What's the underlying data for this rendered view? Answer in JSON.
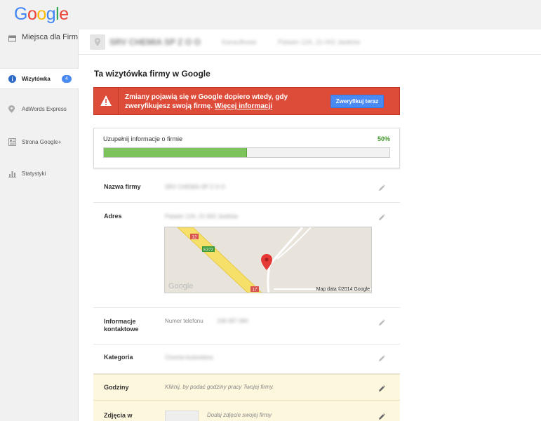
{
  "brand": {
    "logo_letters": [
      {
        "ch": "G",
        "color": "#4285f4"
      },
      {
        "ch": "o",
        "color": "#ea4335"
      },
      {
        "ch": "o",
        "color": "#fbbc05"
      },
      {
        "ch": "g",
        "color": "#4285f4"
      },
      {
        "ch": "l",
        "color": "#34a853"
      },
      {
        "ch": "e",
        "color": "#ea4335"
      }
    ]
  },
  "sidebar": {
    "places": "Miejsca dla Firm",
    "items": [
      {
        "label": "Wizytówka",
        "badge": "4",
        "icon": "info-icon"
      },
      {
        "label": "AdWords Express",
        "icon": "map-pin-icon"
      },
      {
        "label": "Strona Google+",
        "icon": "google-plus-page-icon"
      },
      {
        "label": "Statystyki",
        "icon": "bar-chart-icon"
      }
    ]
  },
  "header": {
    "business_name": "SRV CHEMIA SP Z O O",
    "sub1": "Kanaufkowe",
    "sub2": "Pataein 12A, 21-002 Jastków"
  },
  "main": {
    "title": "Ta wizytówka firmy w Google",
    "alert": {
      "message": "Zmiany pojawią się w Google dopiero wtedy, gdy zweryfikujesz swoją firmę.",
      "link": "Więcej informacji",
      "button": "Zweryfikuj teraz",
      "color": "#dd4b39"
    },
    "completion": {
      "label": "Uzupełnij informacje o firmie",
      "percent_text": "50%",
      "percent": 50
    },
    "rows": {
      "name": {
        "label": "Nazwa firmy",
        "value": "SRV CHEMIA SP Z O O"
      },
      "address": {
        "label": "Adres",
        "value": "Pataein 12A, 21-002 Jastków",
        "map_credit": "Map data ©2014 Google",
        "map_logo": "Google",
        "road_labels": [
          "12",
          "E372",
          "17"
        ]
      },
      "contact": {
        "label": "Informacje kontaktowe",
        "sublabel": "Numer telefonu",
        "value": "108 087 084"
      },
      "category": {
        "label": "Kategoria",
        "value": "Chemia budowlana"
      },
      "hours": {
        "label": "Godziny",
        "hint": "Kliknij, by podać godziny pracy Twojej firmy."
      },
      "photos": {
        "label": "Zdjęcia w",
        "hint": "Dodaj zdjęcie swojej firmy"
      }
    }
  }
}
